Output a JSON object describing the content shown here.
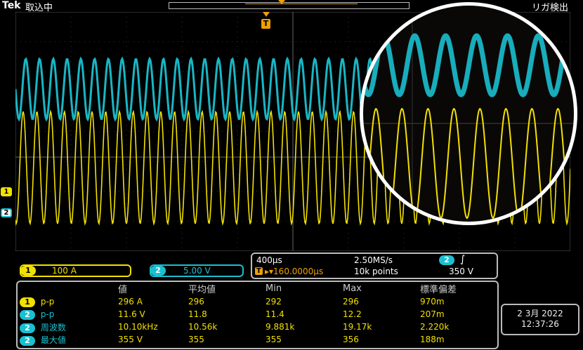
{
  "header": {
    "brand": "Tek",
    "acq_status": "取込中",
    "trigger_status": "リガ検出"
  },
  "markers": {
    "trigger": "T",
    "ch1": "1",
    "ch2": "2"
  },
  "vertical": {
    "ch1": {
      "badge": "1",
      "scale": "100 A"
    },
    "ch2": {
      "badge": "2",
      "scale": "5.00 V"
    }
  },
  "horizontal": {
    "scale": "400µs",
    "sample_rate": "2.50MS/s",
    "trigger_badge": "2",
    "trigger_slope_icon": "rising-edge-icon",
    "delay_marker": "T",
    "delay": "▸▾160.0000µs",
    "record_length": "10k points",
    "trigger_level": "350 V"
  },
  "measurements": {
    "headers": [
      "",
      "値",
      "平均値",
      "Min",
      "Max",
      "標準偏差"
    ],
    "rows": [
      {
        "badge": "1",
        "name": "p-p",
        "color": "#f2e000",
        "value": "296 A",
        "mean": "296",
        "min": "292",
        "max": "296",
        "std": "970m"
      },
      {
        "badge": "2",
        "name": "p-p",
        "color": "#19c0d0",
        "value": "11.6 V",
        "mean": "11.8",
        "min": "11.4",
        "max": "12.2",
        "std": "207m"
      },
      {
        "badge": "2",
        "name": "周波数",
        "color": "#19c0d0",
        "value": "10.10kHz",
        "mean": "10.56k",
        "min": "9.881k",
        "max": "19.17k",
        "std": "2.220k"
      },
      {
        "badge": "2",
        "name": "最大値",
        "color": "#19c0d0",
        "value": "355 V",
        "mean": "355",
        "min": "355",
        "max": "356",
        "std": "188m"
      }
    ]
  },
  "datetime": {
    "date": "2 3月 2022",
    "time": "12:37:26"
  },
  "colors": {
    "ch1": "#f2e000",
    "ch2": "#19c0d0",
    "trigger": "#f0a000",
    "grid": "#3a3a3a"
  }
}
